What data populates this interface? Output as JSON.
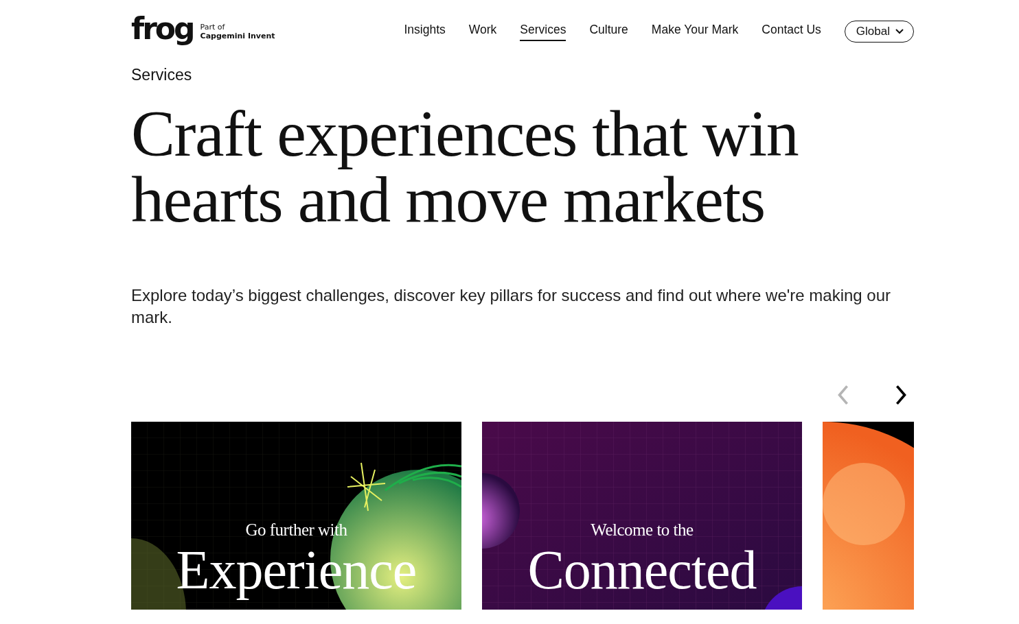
{
  "header": {
    "logo": "frog",
    "logo_tagline_1": "Part of",
    "logo_tagline_2": "Capgemini Invent",
    "nav": [
      {
        "label": "Insights",
        "selected": false
      },
      {
        "label": "Work",
        "selected": false
      },
      {
        "label": "Services",
        "selected": true
      },
      {
        "label": "Culture",
        "selected": false
      },
      {
        "label": "Make Your Mark",
        "selected": false
      },
      {
        "label": "Contact Us",
        "selected": false
      }
    ],
    "region_button": "Global"
  },
  "eyebrow": "Services",
  "headline": "Craft experiences that win hearts and move markets",
  "intro": "Explore today’s biggest challenges, discover key pillars for success and find out where we're making our mark.",
  "carousel": {
    "prev_disabled": true,
    "next_disabled": false,
    "cards": [
      {
        "kind": "picture",
        "eyebrow": "Go further with",
        "title": "Experience"
      },
      {
        "kind": "picture",
        "eyebrow": "Welcome to the",
        "title": "Connected"
      },
      {
        "kind": "picture"
      }
    ]
  }
}
